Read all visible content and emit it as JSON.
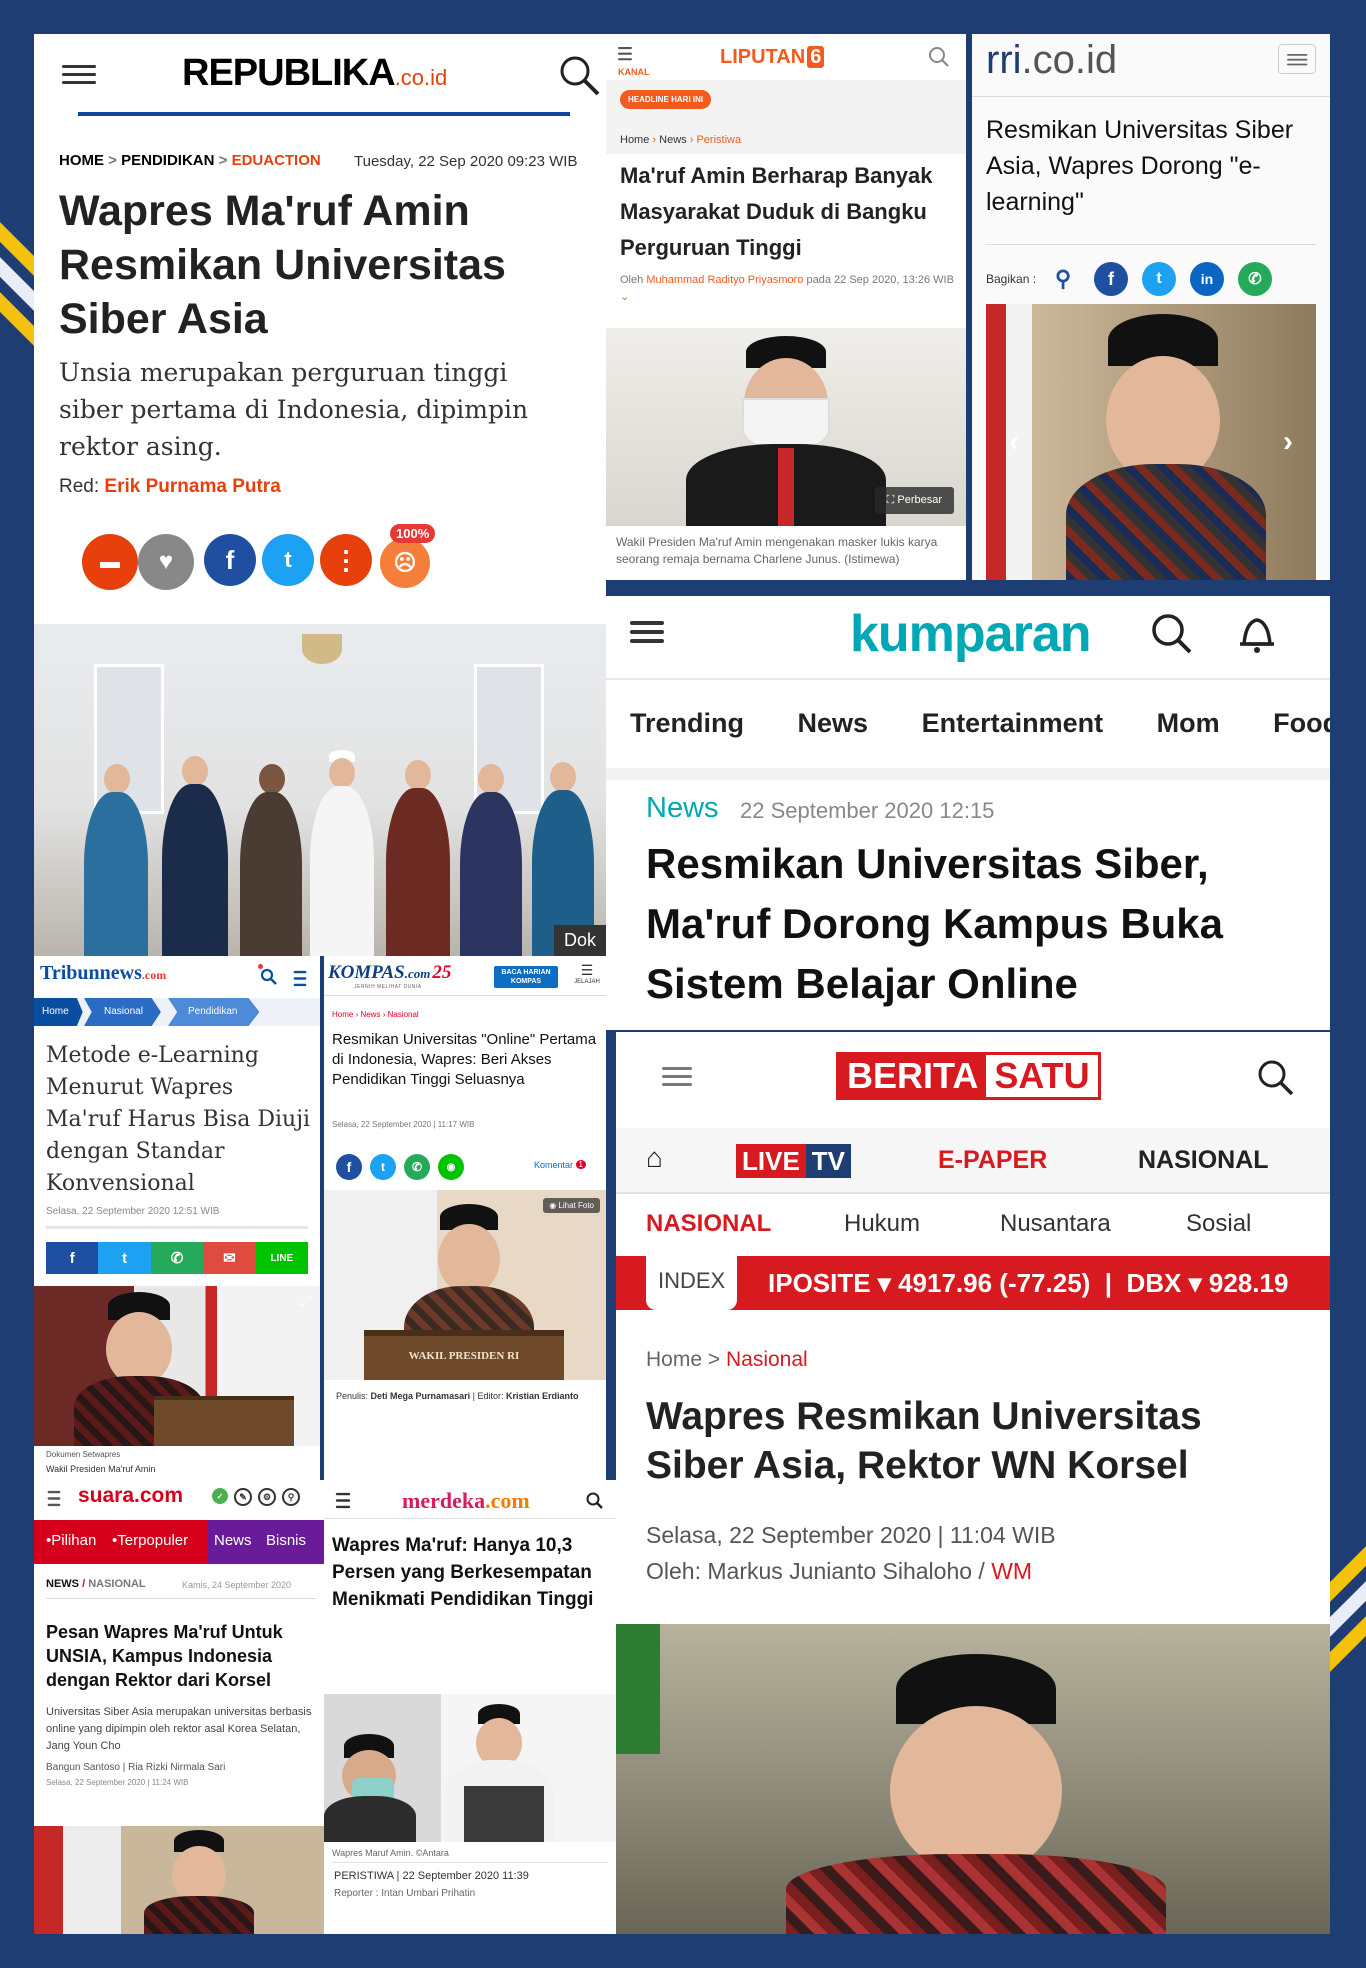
{
  "republika": {
    "logo": "REPUBLIKA",
    "logo_suffix": ".co.id",
    "breadcrumb": {
      "home": "HOME",
      "sep1": ">",
      "pendidikan": "PENDIDIKAN",
      "sep2": ">",
      "education": "EDUACTION"
    },
    "date": "Tuesday, 22 Sep 2020 09:23 WIB",
    "title": "Wapres Ma'ruf Amin Resmikan Universitas Siber Asia",
    "lead": "Unsia merupakan perguruan tinggi siber pertama di Indonesia, dipimpin rektor asing.",
    "red_label": "Red:",
    "red_name": "Erik Purnama Putra",
    "reaction_pct": "100%",
    "photo_label": "Dok"
  },
  "liputan6": {
    "kanal": "KANAL",
    "logo": "LIPUTAN",
    "logo_num": "6",
    "badge": "HEADLINE HARI INI",
    "crumb_home": "Home",
    "crumb_news": "News",
    "crumb_cat": "Peristiwa",
    "title": "Ma'ruf Amin Berharap Banyak Masyarakat Duduk di Bangku Perguruan Tinggi",
    "by": "Oleh",
    "author": "Muhammad Radityo Priyasmoro",
    "date_line": "pada 22 Sep 2020, 13:26",
    "tz": "WIB",
    "zoom": "Perbesar",
    "caption": "Wakil Presiden Ma'ruf Amin mengenakan masker lukis karya seorang remaja bernama Charlene Junus. (Istimewa)"
  },
  "rri": {
    "logo": "rri",
    "logo_suffix": ".co.id",
    "title": "Resmikan Universitas Siber Asia, Wapres Dorong \"e-learning\"",
    "share_label": "Bagikan :"
  },
  "kumparan": {
    "logo": "kumparan",
    "nav": [
      "Trending",
      "News",
      "Entertainment",
      "Mom",
      "Food &"
    ],
    "category": "News",
    "date": "22 September 2020 12:15",
    "title": "Resmikan Universitas Siber, Ma'ruf Dorong Kampus Buka Sistem Belajar Online"
  },
  "beritasatu": {
    "logo_left": "BERITA",
    "logo_right": "SATU",
    "menu": {
      "live_a": "LIVE",
      "live_b": "TV",
      "epaper": "E-PAPER",
      "nasional": "NASIONAL"
    },
    "tabs": [
      "NASIONAL",
      "Hukum",
      "Nusantara",
      "Sosial"
    ],
    "index_label": "INDEX",
    "ticker": "IPOSITE ▾ 4917.96 (-77.25)  |  DBX ▾ 928.19",
    "crumb_home": "Home >",
    "crumb_cat": "Nasional",
    "title": "Wapres Resmikan Universitas Siber Asia, Rektor WN Korsel",
    "date": "Selasa, 22 September 2020 | 11:04 WIB",
    "byline": "Oleh: Markus Junianto Sihaloho /",
    "editor": "WM"
  },
  "tribun": {
    "logo": "Tribunnews",
    "logo_suffix": ".com",
    "crumbs": [
      "Home",
      "Nasional",
      "Pendidikan"
    ],
    "title": "Metode e-Learning Menurut Wapres Ma'ruf Harus Bisa Diuji dengan Standar Konvensional",
    "date": "Selasa, 22 September 2020 12:51 WIB",
    "photo_credit": "Dokumen Setwapres",
    "photo_caption": "Wakil Presiden Ma'ruf Amin"
  },
  "kompas": {
    "logo": "KOMPAS",
    "logo_suffix": ".com",
    "logo_num": "25",
    "tagline": "JERNIH MELIHAT DUNIA",
    "baca": "BACA HARIAN KOMPAS",
    "jelajah": "JELAJAH",
    "crumb_home": "Home",
    "crumb_news": "News",
    "crumb_cat": "Nasional",
    "title": "Resmikan Universitas \"Online\" Pertama di Indonesia, Wapres: Beri Akses Pendidikan Tinggi Seluasnya",
    "date": "Selasa, 22 September 2020 | 11:17 WIB",
    "komentar": "Komentar",
    "komentar_count": "1",
    "lihat_foto": "Lihat Foto",
    "podium_text": "WAKIL PRESIDEN RI",
    "penulis_label": "Penulis:",
    "penulis": "Deti Mega Purnamasari",
    "editor_label": "| Editor:",
    "editor": "Kristian Erdianto"
  },
  "suara": {
    "logo": "suara",
    "logo_suffix": ".com",
    "nav": [
      "•Pilihan",
      "•Terpopuler",
      "News",
      "Bisnis"
    ],
    "section": "NEWS",
    "subsection": "NASIONAL",
    "top_date": "Kamis, 24 September 2020",
    "title": "Pesan Wapres Ma'ruf Untuk UNSIA, Kampus Indonesia dengan Rektor dari Korsel",
    "lead": "Universitas Siber Asia merupakan universitas berbasis online yang dipimpin oleh rektor asal Korea Selatan, Jang Youn Cho",
    "authors": "Bangun Santoso | Ria Rizki Nirmala Sari",
    "date": "Selasa, 22 September 2020 | 11:24 WIB"
  },
  "merdeka": {
    "logo": "merdeka",
    "logo_suffix": ".com",
    "title": "Wapres Ma'ruf: Hanya 10,3 Persen yang Berkesempatan Menikmati Pendidikan Tinggi",
    "caption": "Wapres Maruf Amin. ©Antara",
    "date": "PERISTIWA | 22 September 2020 11:39",
    "reporter": "Reporter : Intan Umbari Prihatin"
  },
  "colors": {
    "republika_red": "#e8400c",
    "liputan_orange": "#f25a1e",
    "kumparan_teal": "#00a8b5",
    "beritasatu_red": "#d71920",
    "tribun_blue": "#0a4ea2",
    "suara_red": "#d6001c",
    "kompas_red": "#e4002b",
    "background_navy": "#1d3d73",
    "accent_yellow": "#f4c20d"
  }
}
